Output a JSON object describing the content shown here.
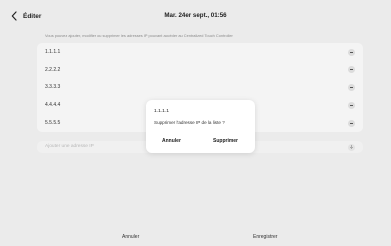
{
  "header": {
    "back_label": "Éditer",
    "clock": "Mar. 24er sept., 01:56"
  },
  "description": "Vous pouvez ajouter, modifier ou supprimer les adresses IP pouvant accéder au Centralized Touch Controller",
  "ip_list": [
    {
      "address": "1.1.1.1"
    },
    {
      "address": "2.2.2.2"
    },
    {
      "address": "3.3.3.3"
    },
    {
      "address": "4.4.4.4"
    },
    {
      "address": "5.5.5.5"
    }
  ],
  "add_field": {
    "placeholder": "Ajouter une adresse IP"
  },
  "footer": {
    "cancel_label": "Annuler",
    "save_label": "Enregistrer"
  },
  "dialog": {
    "title": "1.1.1.1",
    "message": "Supprimer l'adresse IP de la liste ?",
    "cancel_label": "Annuler",
    "confirm_label": "Supprimer"
  },
  "colors": {
    "background": "#ebebeb",
    "card": "#f4f4f4",
    "dialog": "#ffffff"
  },
  "icons": {
    "back": "chevron-left-icon",
    "remove": "minus-circle-icon",
    "add": "plus-circle-icon"
  }
}
